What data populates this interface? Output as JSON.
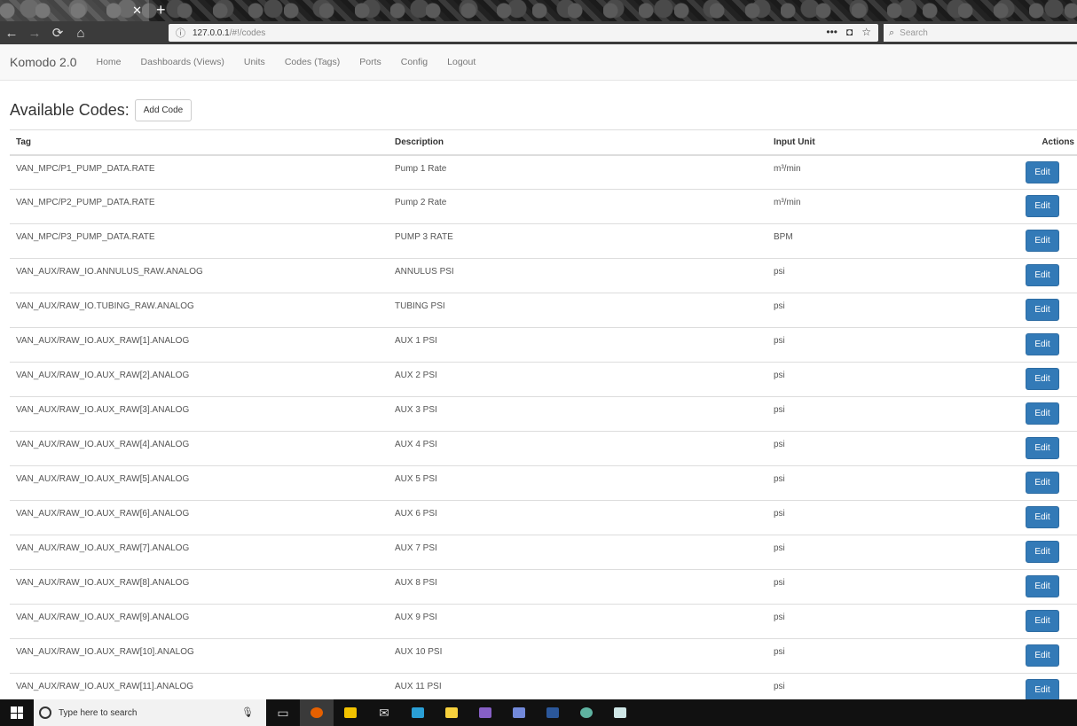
{
  "browser": {
    "tab_title": "",
    "url_host": "127.0.0.1",
    "url_path": "/#!/codes",
    "search_placeholder": "Search"
  },
  "app": {
    "brand": "Komodo 2.0",
    "nav": [
      "Home",
      "Dashboards (Views)",
      "Units",
      "Codes (Tags)",
      "Ports",
      "Config",
      "Logout"
    ]
  },
  "page": {
    "title": "Available Codes:",
    "add_button": "Add Code"
  },
  "table": {
    "headers": {
      "tag": "Tag",
      "description": "Description",
      "unit": "Input Unit",
      "actions": "Actions"
    },
    "edit_label": "Edit",
    "rows": [
      {
        "tag": "VAN_MPC/P1_PUMP_DATA.RATE",
        "description": "Pump 1 Rate",
        "unit": "m³/min"
      },
      {
        "tag": "VAN_MPC/P2_PUMP_DATA.RATE",
        "description": "Pump 2 Rate",
        "unit": "m³/min"
      },
      {
        "tag": "VAN_MPC/P3_PUMP_DATA.RATE",
        "description": "PUMP 3 RATE",
        "unit": "BPM"
      },
      {
        "tag": "VAN_AUX/RAW_IO.ANNULUS_RAW.ANALOG",
        "description": "ANNULUS PSI",
        "unit": "psi"
      },
      {
        "tag": "VAN_AUX/RAW_IO.TUBING_RAW.ANALOG",
        "description": "TUBING PSI",
        "unit": "psi"
      },
      {
        "tag": "VAN_AUX/RAW_IO.AUX_RAW[1].ANALOG",
        "description": "AUX 1 PSI",
        "unit": "psi"
      },
      {
        "tag": "VAN_AUX/RAW_IO.AUX_RAW[2].ANALOG",
        "description": "AUX 2 PSI",
        "unit": "psi"
      },
      {
        "tag": "VAN_AUX/RAW_IO.AUX_RAW[3].ANALOG",
        "description": "AUX 3 PSI",
        "unit": "psi"
      },
      {
        "tag": "VAN_AUX/RAW_IO.AUX_RAW[4].ANALOG",
        "description": "AUX 4 PSI",
        "unit": "psi"
      },
      {
        "tag": "VAN_AUX/RAW_IO.AUX_RAW[5].ANALOG",
        "description": "AUX 5 PSI",
        "unit": "psi"
      },
      {
        "tag": "VAN_AUX/RAW_IO.AUX_RAW[6].ANALOG",
        "description": "AUX 6 PSI",
        "unit": "psi"
      },
      {
        "tag": "VAN_AUX/RAW_IO.AUX_RAW[7].ANALOG",
        "description": "AUX 7 PSI",
        "unit": "psi"
      },
      {
        "tag": "VAN_AUX/RAW_IO.AUX_RAW[8].ANALOG",
        "description": "AUX 8 PSI",
        "unit": "psi"
      },
      {
        "tag": "VAN_AUX/RAW_IO.AUX_RAW[9].ANALOG",
        "description": "AUX 9 PSI",
        "unit": "psi"
      },
      {
        "tag": "VAN_AUX/RAW_IO.AUX_RAW[10].ANALOG",
        "description": "AUX 10 PSI",
        "unit": "psi"
      },
      {
        "tag": "VAN_AUX/RAW_IO.AUX_RAW[11].ANALOG",
        "description": "AUX 11 PSI",
        "unit": "psi"
      }
    ]
  },
  "taskbar": {
    "search_placeholder": "Type here to search"
  },
  "colors": {
    "primary": "#337ab7",
    "navbar_bg": "#f8f8f8",
    "taskbar_bg": "#111111"
  }
}
